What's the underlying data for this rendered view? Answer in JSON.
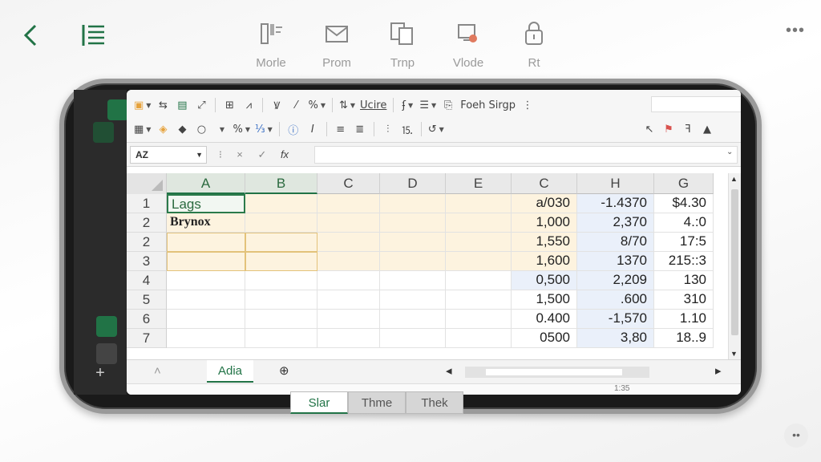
{
  "top_bar": {
    "tools": [
      {
        "label": "Morle",
        "icon": "layout-icon"
      },
      {
        "label": "Prom",
        "icon": "mail-icon"
      },
      {
        "label": "Trnp",
        "icon": "copy-icon"
      },
      {
        "label": "Vlode",
        "icon": "video-icon"
      },
      {
        "label": "Rt",
        "icon": "lock-icon"
      }
    ]
  },
  "ribbon": {
    "row1_labels": {
      "format": "Ucire",
      "font": "Foeh Sirgp"
    },
    "row1_icons": [
      "paste-icon",
      "format-painter-icon",
      "table-icon",
      "expand-icon",
      "borders-icon",
      "chart-icon",
      "strikethrough-icon",
      "italic-format-icon",
      "percent-icon",
      "sort-icon",
      "filter-icon",
      "list-icon",
      "insert-icon"
    ],
    "row2_icons": [
      "cell-style-icon",
      "fill-color-icon",
      "shape-icon",
      "dropdown-icon",
      "percent-icon",
      "number-format-icon",
      "paint-icon",
      "italic-icon",
      "align-left-icon",
      "align-center-icon",
      "wrap-icon",
      "number-icon",
      "undo-icon",
      "cursor-icon",
      "pin-icon",
      "function-icon",
      "collapse-icon"
    ]
  },
  "formula_bar": {
    "name_box": "AZ",
    "cancel": "×",
    "enter": "✓",
    "fx": "fx"
  },
  "grid": {
    "columns": [
      "A",
      "B",
      "C",
      "D",
      "E",
      "C",
      "H",
      "G"
    ],
    "rows": [
      {
        "header": "1",
        "cells": [
          "Lags",
          "",
          "",
          "",
          "",
          "a/030",
          "-1.4370",
          "$4.30"
        ]
      },
      {
        "header": "2",
        "cells": [
          "Brynox",
          "",
          "",
          "",
          "",
          "1,000",
          "2,370",
          "4.:0"
        ]
      },
      {
        "header": "2",
        "cells": [
          "",
          "",
          "",
          "",
          "",
          "1,550",
          "8/70",
          "17:5"
        ]
      },
      {
        "header": "3",
        "cells": [
          "",
          "",
          "",
          "",
          "",
          "1,600",
          "1370",
          "215::3"
        ]
      },
      {
        "header": "4",
        "cells": [
          "",
          "",
          "",
          "",
          "",
          "0,500",
          "2,209",
          "130"
        ]
      },
      {
        "header": "5",
        "cells": [
          "",
          "",
          "",
          "",
          "",
          "1,500",
          ".600",
          "310"
        ]
      },
      {
        "header": "6",
        "cells": [
          "",
          "",
          "",
          "",
          "",
          "0.400",
          "-1,570",
          "1.10"
        ]
      },
      {
        "header": "7",
        "cells": [
          "",
          "",
          "",
          "",
          "",
          "0500",
          "3,80",
          "18..9"
        ]
      }
    ]
  },
  "sheet_tabs": {
    "active": "Adia",
    "add": "+",
    "bottom_readout": "1:35"
  },
  "bottom_tabs": [
    "Slar",
    "Thme",
    "Thek"
  ],
  "colors": {
    "accent": "#217346",
    "tint": "#fdf3df",
    "blue_tint": "#eaf0fa"
  }
}
